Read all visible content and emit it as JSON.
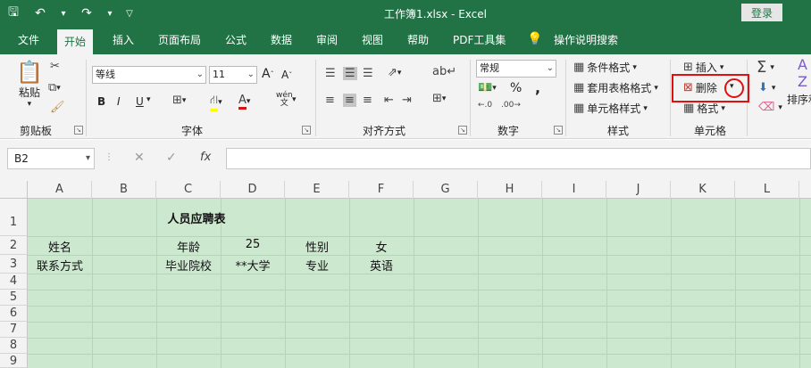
{
  "titlebar": {
    "title": "工作簿1.xlsx  -  Excel",
    "login": "登录"
  },
  "tabs": [
    "文件",
    "开始",
    "插入",
    "页面布局",
    "公式",
    "数据",
    "审阅",
    "视图",
    "帮助",
    "PDF工具集",
    "操作说明搜索"
  ],
  "ribbon": {
    "clipboard": {
      "label": "剪贴板",
      "paste": "粘贴"
    },
    "font": {
      "label": "字体",
      "font_name": "等线",
      "font_size": "11",
      "bold": "B",
      "italic": "I",
      "underline": "U",
      "wen": "wén\n文"
    },
    "align": {
      "label": "对齐方式"
    },
    "number": {
      "label": "数字",
      "format": "常规",
      "percent": "%",
      "comma": ","
    },
    "styles": {
      "label": "样式",
      "cond": "条件格式",
      "table": "套用表格格式",
      "cell": "单元格样式"
    },
    "cells": {
      "label": "单元格",
      "insert": "插入",
      "delete": "删除",
      "format": "格式"
    },
    "edit": {
      "sort": "排序和"
    }
  },
  "formula_bar": {
    "name_box": "B2",
    "formula": "",
    "fx": "fx"
  },
  "columns": [
    "A",
    "B",
    "C",
    "D",
    "E",
    "F",
    "G",
    "H",
    "I",
    "J",
    "K",
    "L"
  ],
  "rows": [
    "1",
    "2",
    "3",
    "4",
    "5",
    "6",
    "7",
    "8",
    "9"
  ],
  "cells": {
    "title": "人员应聘表",
    "a2": "姓名",
    "c2": "年龄",
    "d2": "25",
    "e2": "性别",
    "f2": "女",
    "a3": "联系方式",
    "c3": "毕业院校",
    "d3": "**大学",
    "e3": "专业",
    "f3": "英语"
  },
  "colors": {
    "accent": "#217346",
    "grid_bg": "#cce8cf",
    "highlight": "#e01010"
  }
}
